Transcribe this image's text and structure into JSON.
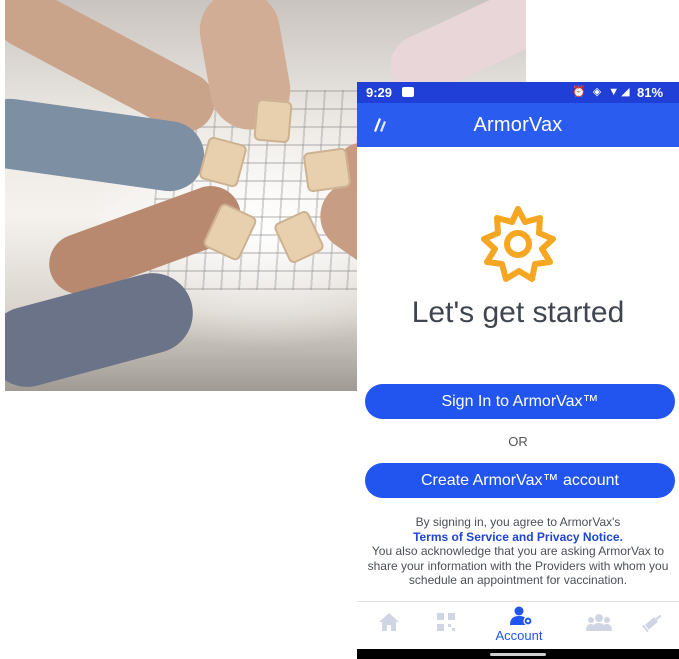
{
  "photo": {
    "description_icon": "people-holding-phones-photo"
  },
  "status_bar": {
    "time": "9:29",
    "sys_icons": "⏰ ◈ ▼◢",
    "battery": "81%"
  },
  "app_bar": {
    "title": "ArmorVax"
  },
  "main": {
    "headline": "Let's get started",
    "signin_label": "Sign In to ArmorVax™",
    "or_label": "OR",
    "create_label": "Create ArmorVax™ account"
  },
  "legal": {
    "line1": "By signing in, you agree to ArmorVax's",
    "link": "Terms of Service and Privacy Notice.",
    "line2": "You also acknowledge that you are asking ArmorVax to share your information with the Providers with whom you schedule an appointment for vaccination."
  },
  "bottom_nav": {
    "items": [
      {
        "icon": "home-icon"
      },
      {
        "icon": "qr-code-icon"
      },
      {
        "icon": "account-icon",
        "label": "Account"
      },
      {
        "icon": "group-icon"
      },
      {
        "icon": "syringe-icon"
      }
    ]
  },
  "colors": {
    "primary": "#2255f0",
    "status_bar": "#1f3fd6",
    "gear": "#f5a623",
    "inactive_icon": "#cfd5e2"
  }
}
